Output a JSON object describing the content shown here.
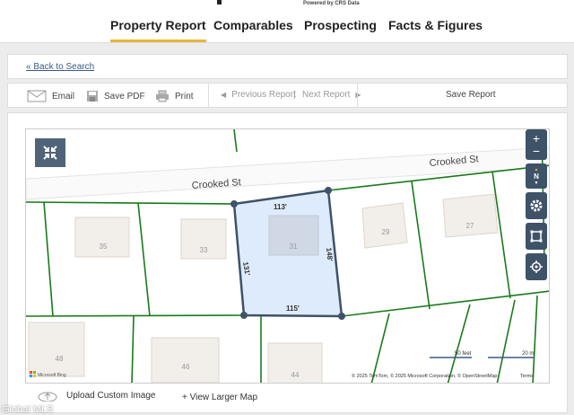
{
  "header": {
    "powered_by": "Powered by CRS Data",
    "tabs": [
      {
        "label": "Property Report"
      },
      {
        "label": "Comparables"
      },
      {
        "label": "Prospecting"
      },
      {
        "label": "Facts & Figures"
      }
    ]
  },
  "back_link": "« Back to Search",
  "toolbar": {
    "email": "Email",
    "save_pdf": "Save PDF",
    "print": "Print",
    "previous": "Previous Report",
    "divider": "|",
    "next": "Next Report",
    "save_report": "Save Report"
  },
  "map": {
    "street": "Crooked St",
    "lots": {
      "l35": "35",
      "l33": "33",
      "l31": "31",
      "l29": "29",
      "l27": "27",
      "l48": "48",
      "l46": "46",
      "l44": "44"
    },
    "dims": {
      "top": "113'",
      "left": "131'",
      "right": "148'",
      "bottom": "115'"
    },
    "scale_feet": "50 feet",
    "scale_m": "20 m",
    "attribution": "© 2025 TomTom, © 2025 Microsoft Corporation, © OpenStreetMap",
    "terms": "Terms",
    "brand": "Microsoft Bing",
    "north": "N",
    "zoom_in": "+",
    "zoom_out": "−"
  },
  "footer": {
    "upload": "Upload Custom Image",
    "view_larger": "+ View Larger Map",
    "watermark": "Global MLS"
  },
  "colors": {
    "accent": "#e8b53b",
    "parcel_line": "#1a7a1a",
    "selected_fill": "#d8e8fb",
    "selected_stroke": "#3e5268"
  }
}
